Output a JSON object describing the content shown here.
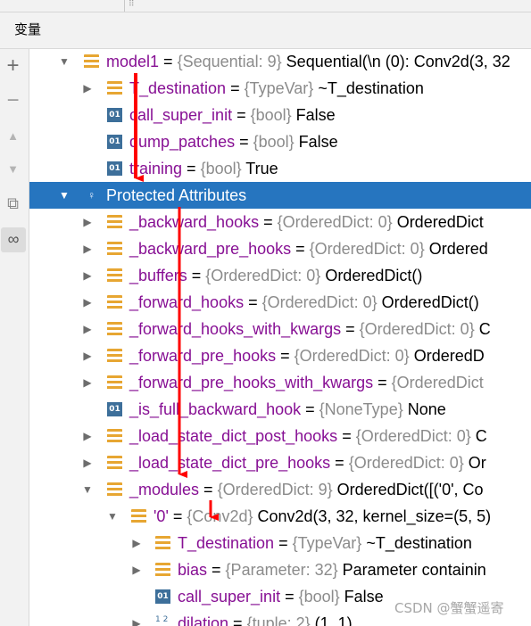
{
  "topbar": {
    "grip": "⠿"
  },
  "panel": {
    "title": "变量"
  },
  "toolbar": {
    "add": "+",
    "remove": "−",
    "up": "▲",
    "down": "▼",
    "copy": "⧉",
    "watch": "∞"
  },
  "tree_rows": [
    {
      "arrow": "▼",
      "icon": "struct",
      "name": "model1",
      "eq": " = ",
      "type": "{Sequential: 9}",
      "value": " Sequential(\\n  (0): Conv2d(3, 32"
    },
    {
      "arrow": "▶",
      "icon": "struct",
      "name": "T_destination",
      "eq": " = ",
      "type": "{TypeVar}",
      "value": " ~T_destination"
    },
    {
      "arrow": "",
      "icon": "bool",
      "name": "call_super_init",
      "eq": " = ",
      "type": "{bool}",
      "value": " False"
    },
    {
      "arrow": "",
      "icon": "bool",
      "name": "dump_patches",
      "eq": " = ",
      "type": "{bool}",
      "value": " False"
    },
    {
      "arrow": "",
      "icon": "bool",
      "name": "training",
      "eq": " = ",
      "type": "{bool}",
      "value": " True"
    },
    {
      "arrow": "▼",
      "icon": "key",
      "name": "Protected Attributes",
      "eq": "",
      "type": "",
      "value": "",
      "selected": true
    },
    {
      "arrow": "▶",
      "icon": "struct",
      "name": "_backward_hooks",
      "eq": " = ",
      "type": "{OrderedDict: 0}",
      "value": " OrderedDict"
    },
    {
      "arrow": "▶",
      "icon": "struct",
      "name": "_backward_pre_hooks",
      "eq": " = ",
      "type": "{OrderedDict: 0}",
      "value": " Ordered"
    },
    {
      "arrow": "▶",
      "icon": "struct",
      "name": "_buffers",
      "eq": " = ",
      "type": "{OrderedDict: 0}",
      "value": " OrderedDict()"
    },
    {
      "arrow": "▶",
      "icon": "struct",
      "name": "_forward_hooks",
      "eq": " = ",
      "type": "{OrderedDict: 0}",
      "value": " OrderedDict()"
    },
    {
      "arrow": "▶",
      "icon": "struct",
      "name": "_forward_hooks_with_kwargs",
      "eq": " = ",
      "type": "{OrderedDict: 0}",
      "value": " C"
    },
    {
      "arrow": "▶",
      "icon": "struct",
      "name": "_forward_pre_hooks",
      "eq": " = ",
      "type": "{OrderedDict: 0}",
      "value": " OrderedD"
    },
    {
      "arrow": "▶",
      "icon": "struct",
      "name": "_forward_pre_hooks_with_kwargs",
      "eq": " = ",
      "type": "{OrderedDict",
      "value": ""
    },
    {
      "arrow": "",
      "icon": "bool",
      "name": "_is_full_backward_hook",
      "eq": " = ",
      "type": "{NoneType}",
      "value": " None"
    },
    {
      "arrow": "▶",
      "icon": "struct",
      "name": "_load_state_dict_post_hooks",
      "eq": " = ",
      "type": "{OrderedDict: 0}",
      "value": " C"
    },
    {
      "arrow": "▶",
      "icon": "struct",
      "name": "_load_state_dict_pre_hooks",
      "eq": " = ",
      "type": "{OrderedDict: 0}",
      "value": " Or"
    },
    {
      "arrow": "▼",
      "icon": "struct",
      "name": "_modules",
      "eq": " = ",
      "type": "{OrderedDict: 9}",
      "value": " OrderedDict([('0', Co"
    },
    {
      "arrow": "▼",
      "icon": "struct",
      "name": "'0'",
      "eq": " = ",
      "type": "{Conv2d}",
      "value": " Conv2d(3, 32, kernel_size=(5, 5)"
    },
    {
      "arrow": "▶",
      "icon": "struct",
      "name": "T_destination",
      "eq": " = ",
      "type": "{TypeVar}",
      "value": " ~T_destination"
    },
    {
      "arrow": "▶",
      "icon": "struct",
      "name": "bias",
      "eq": " = ",
      "type": "{Parameter: 32}",
      "value": " Parameter containin"
    },
    {
      "arrow": "",
      "icon": "bool",
      "name": "call_super_init",
      "eq": " = ",
      "type": "{bool}",
      "value": " False"
    },
    {
      "arrow": "▶",
      "icon": "tuple",
      "name": "dilation",
      "eq": " = ",
      "type": "{tuple: 2}",
      "value": " (1, 1)"
    }
  ],
  "icon_glyphs": {
    "bool": "01",
    "key": "♀",
    "tuple": "1 2"
  },
  "watermark": "CSDN @蟹蟹遥寄",
  "colors": {
    "selection": "#2675bf",
    "name": "#871094",
    "type": "#8b8b8b",
    "struct_icon": "#e7a632",
    "bool_icon": "#3d6f9a",
    "annotation_arrow": "#ff0000"
  }
}
